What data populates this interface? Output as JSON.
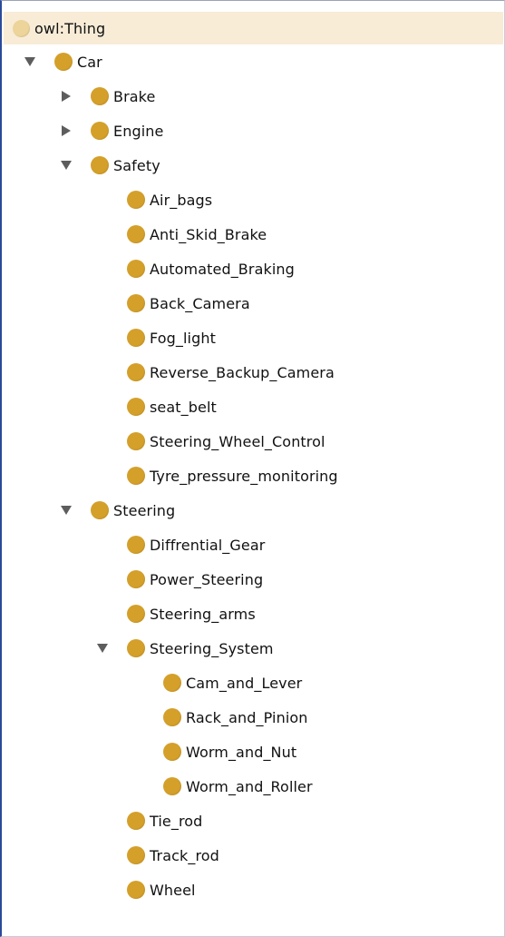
{
  "tree": {
    "root": {
      "label": "owl:Thing",
      "selected": true
    },
    "car": {
      "label": "Car",
      "expanded": true
    },
    "brake": {
      "label": "Brake",
      "expanded": false
    },
    "engine": {
      "label": "Engine",
      "expanded": false
    },
    "safety": {
      "label": "Safety",
      "expanded": true,
      "children": [
        "Air_bags",
        "Anti_Skid_Brake",
        "Automated_Braking",
        "Back_Camera",
        "Fog_light",
        "Reverse_Backup_Camera",
        "seat_belt",
        "Steering_Wheel_Control",
        "Tyre_pressure_monitoring"
      ]
    },
    "steering": {
      "label": "Steering",
      "expanded": true,
      "children_before": [
        "Diffrential_Gear",
        "Power_Steering",
        "Steering_arms"
      ],
      "steering_system": {
        "label": "Steering_System",
        "expanded": true,
        "children": [
          "Cam_and_Lever",
          "Rack_and_Pinion",
          "Worm_and_Nut",
          "Worm_and_Roller"
        ]
      },
      "children_after": [
        "Tie_rod",
        "Track_rod",
        "Wheel"
      ]
    }
  },
  "colors": {
    "class_icon": "#d4a02a",
    "root_icon": "#ecd49a",
    "selection": "#f8ecd7",
    "frame_accent": "#2a4a9a"
  },
  "icons": {
    "class": "class-circle-icon",
    "expanded": "triangle-down-icon",
    "collapsed": "triangle-right-icon"
  }
}
